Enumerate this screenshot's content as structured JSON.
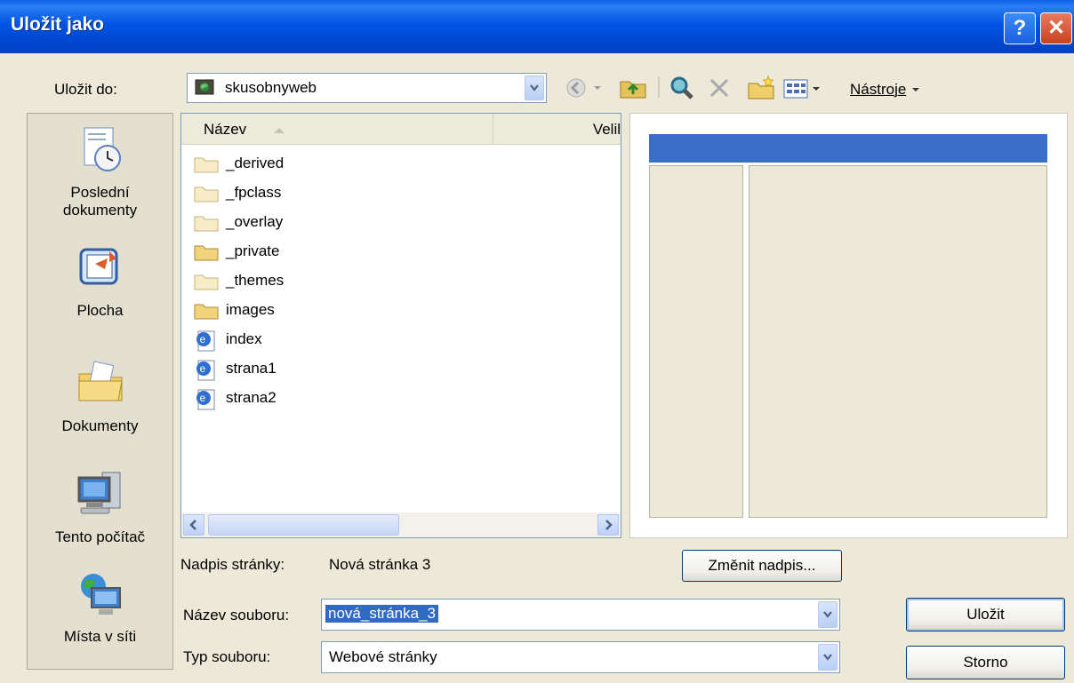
{
  "window": {
    "title": "Uložit jako",
    "help_glyph": "?",
    "close_glyph": "✕"
  },
  "location": {
    "label": "Uložit do:",
    "value": "skusobnyweb"
  },
  "toolbar": {
    "tools_label": "Nástroje"
  },
  "places": [
    {
      "label_line1": "Poslední",
      "label_line2": "dokumenty",
      "icon": "recent-documents-icon"
    },
    {
      "label_line1": "Plocha",
      "label_line2": "",
      "icon": "desktop-icon"
    },
    {
      "label_line1": "Dokumenty",
      "label_line2": "",
      "icon": "my-documents-icon"
    },
    {
      "label_line1": "Tento počítač",
      "label_line2": "",
      "icon": "my-computer-icon"
    },
    {
      "label_line1": "Místa v síti",
      "label_line2": "",
      "icon": "network-places-icon"
    }
  ],
  "columns": {
    "name": "Název",
    "size": "Velil"
  },
  "files": [
    {
      "name": "_derived",
      "type": "folder-hidden"
    },
    {
      "name": "_fpclass",
      "type": "folder-hidden"
    },
    {
      "name": "_overlay",
      "type": "folder-hidden"
    },
    {
      "name": "_private",
      "type": "folder"
    },
    {
      "name": "_themes",
      "type": "folder-hidden"
    },
    {
      "name": "images",
      "type": "folder"
    },
    {
      "name": "index",
      "type": "html"
    },
    {
      "name": "strana1",
      "type": "html"
    },
    {
      "name": "strana2",
      "type": "html"
    }
  ],
  "page_title": {
    "label": "Nadpis stránky:",
    "value": "Nová stránka 3",
    "change_button": "Změnit nadpis..."
  },
  "filename": {
    "label": "Název souboru:",
    "value": "nová_stránka_3"
  },
  "filetype": {
    "label": "Typ souboru:",
    "value": "Webové stránky"
  },
  "buttons": {
    "save": "Uložit",
    "cancel": "Storno"
  },
  "colors": {
    "titlebar": "#0054e3",
    "dialog_bg": "#ece9d8",
    "preview_header": "#3a6fc9",
    "selection": "#316ac5"
  }
}
